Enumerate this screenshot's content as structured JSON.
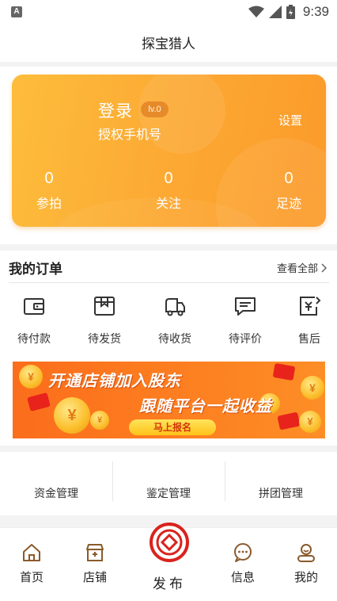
{
  "status_bar": {
    "time": "9:39"
  },
  "header": {
    "title": "探宝猎人"
  },
  "profile": {
    "login_label": "登录",
    "level": "lv.0",
    "phone_label": "授权手机号",
    "settings_label": "设置",
    "stats": [
      {
        "value": "0",
        "label": "参拍"
      },
      {
        "value": "0",
        "label": "关注"
      },
      {
        "value": "0",
        "label": "足迹"
      }
    ]
  },
  "orders": {
    "title": "我的订单",
    "view_all": "查看全部",
    "items": [
      {
        "label": "待付款",
        "icon": "wallet-icon"
      },
      {
        "label": "待发货",
        "icon": "package-icon"
      },
      {
        "label": "待收货",
        "icon": "truck-icon"
      },
      {
        "label": "待评价",
        "icon": "comment-icon"
      },
      {
        "label": "售后",
        "icon": "refund-icon"
      }
    ]
  },
  "banner": {
    "line1": "开通店铺加入股东",
    "line2": "跟随平台一起收益",
    "cta": "马上报名",
    "coin_symbol": "¥"
  },
  "management": {
    "items": [
      {
        "label": "资金管理"
      },
      {
        "label": "鉴定管理"
      },
      {
        "label": "拼团管理"
      }
    ]
  },
  "tab_bar": {
    "items": [
      {
        "label": "首页",
        "icon": "home-icon"
      },
      {
        "label": "店铺",
        "icon": "store-icon"
      },
      {
        "label": "发布",
        "icon": "publish-logo-icon"
      },
      {
        "label": "信息",
        "icon": "message-icon"
      },
      {
        "label": "我的",
        "icon": "profile-icon"
      }
    ]
  },
  "colors": {
    "card_gradient_start": "#fdbd3c",
    "card_gradient_end": "#fb9a2a",
    "banner_orange": "#fb6d1c",
    "publish_red": "#d9231c"
  }
}
